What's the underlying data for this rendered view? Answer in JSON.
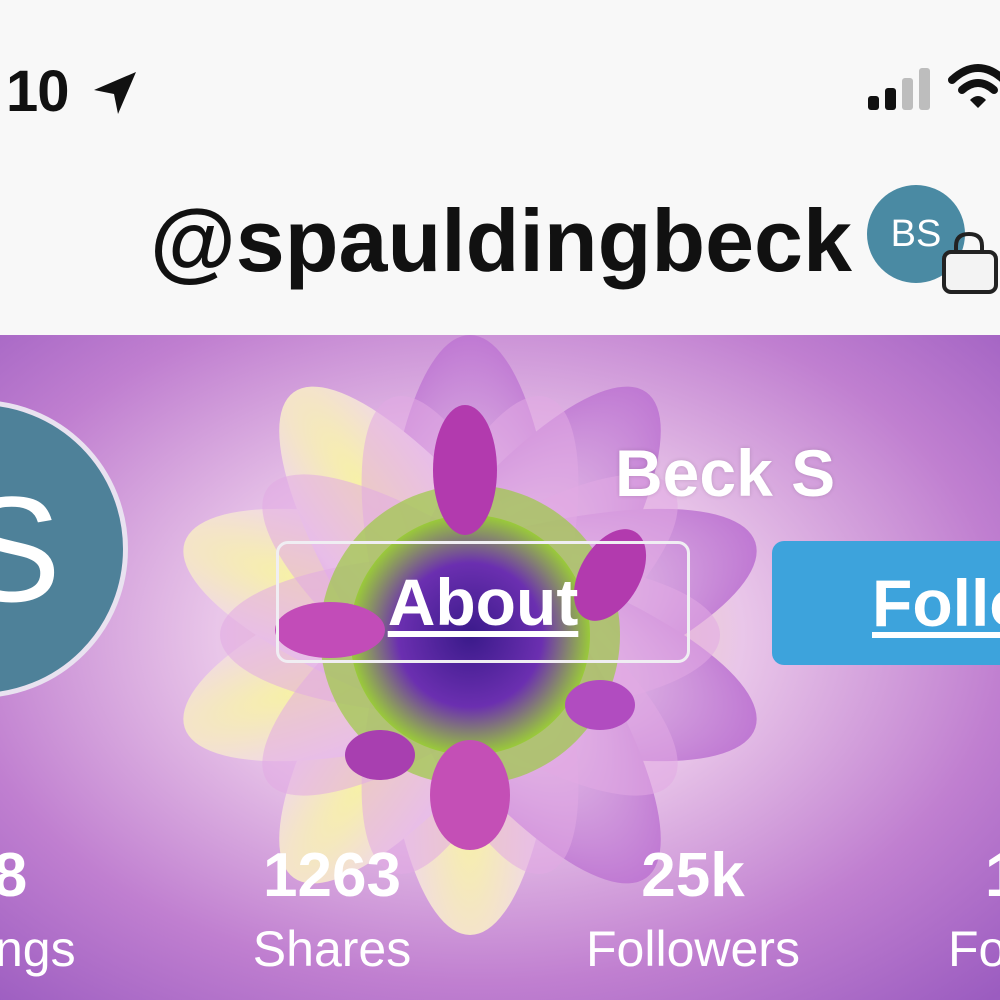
{
  "status_bar": {
    "time": "10",
    "icons": [
      "location-arrow-icon",
      "cellular-signal-icon",
      "wifi-icon"
    ]
  },
  "header": {
    "username": "@spauldingbeck",
    "avatar_initials": "BS",
    "bag_icon": "shopping-bag-icon"
  },
  "profile": {
    "avatar_initial": "S",
    "display_name": "Beck S",
    "about_label": "About",
    "follow_label": "Follow"
  },
  "stats": [
    {
      "value": "8",
      "label": "ngs"
    },
    {
      "value": "1263",
      "label": "Shares"
    },
    {
      "value": "25k",
      "label": "Followers"
    },
    {
      "value": "1",
      "label": "Fo"
    }
  ],
  "colors": {
    "avatar": "#4e8199",
    "follow_button": "#3da3dc",
    "status_bg": "#f8f8f8"
  }
}
